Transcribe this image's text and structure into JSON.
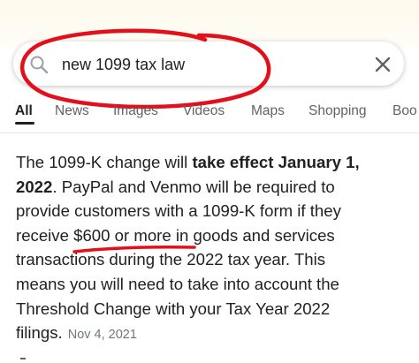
{
  "search": {
    "query": "new 1099 tax law"
  },
  "icons": {
    "search": "search-icon",
    "clear": "close-icon"
  },
  "tabs": [
    {
      "label": "All",
      "active": true
    },
    {
      "label": "News",
      "active": false
    },
    {
      "label": "Images",
      "active": false
    },
    {
      "label": "Videos",
      "active": false
    },
    {
      "label": "Maps",
      "active": false
    },
    {
      "label": "Shopping",
      "active": false
    },
    {
      "label": "Boo",
      "active": false
    }
  ],
  "snippet": {
    "l1_a": "The 1099-K change will ",
    "l1_b": "take effect January 1,",
    "l2_a": "2022",
    "l2_b": ". PayPal and Venmo will be required to",
    "l3": "provide customers with a 1099-K form if they",
    "l4": "receive $600 or more in goods and services",
    "l5": "transactions during the 2022 tax year. This",
    "l6": "means you will need to take into account the",
    "l7": "Threshold Change with your Tax Year 2022",
    "l8": "filings.",
    "date": "Nov 4, 2021"
  },
  "colors": {
    "annotation": "#e3101b",
    "text": "#202124",
    "muted": "#5f6368",
    "date": "#70757a"
  }
}
